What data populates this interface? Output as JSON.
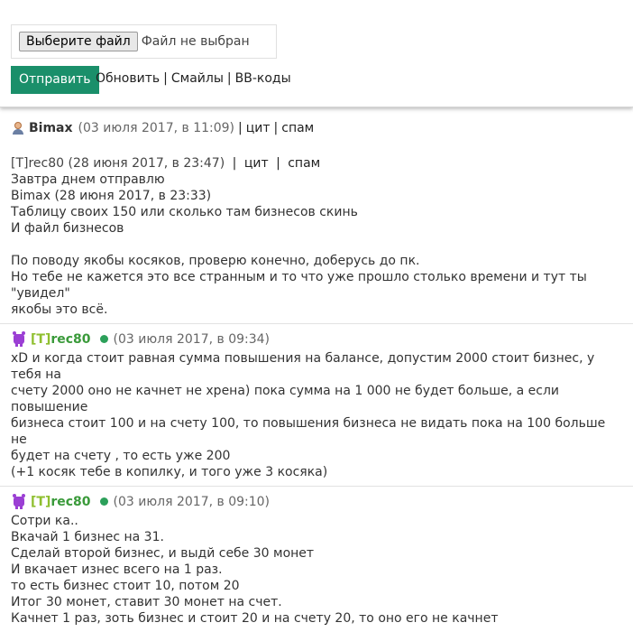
{
  "form": {
    "file_button": "Выберите файл",
    "file_status": "Файл не выбран",
    "submit": "Отправить",
    "refresh": "Обновить",
    "smiles": "Смайлы",
    "bbcodes": "BB-коды",
    "separator": "|"
  },
  "meta": {
    "quote": "цит",
    "spam": "спам"
  },
  "posts": [
    {
      "author": "Bimax",
      "date": "(03 июля 2017, в 11:09)",
      "quote_author_line": "[T]rec80 (28 июня 2017, в 23:47)",
      "quote_lines": [
        "Завтра днем отправлю"
      ],
      "nested_author_line": "Bimax (28 июня 2017, в 23:33)",
      "nested_lines": [
        "Таблицу своих 150 или сколько там бизнесов скинь",
        "И файл бизнесов"
      ],
      "body_lines": [
        "По поводу якобы косяков, проверю конечно, доберусь до пк.",
        "Но тебе не кажется это все странным и то что уже прошло столько времени и тут ты \"увидел\"",
        "якобы это всё."
      ]
    },
    {
      "author_bracket": "[T]",
      "author_rest": "rec80",
      "date": "(03 июля 2017, в 09:34)",
      "body_lines": [
        "xD и когда стоит равная сумма повышения на балансе, допустим 2000 стоит бизнес, у тебя на",
        "счету 2000 оно не качнет не хрена) пока сумма на 1 000 не будет больше, а если повышение",
        "бизнеса стоит 100 и на счету 100, то повышения бизнеса не видать пока на 100 больше не",
        "будет на счету , то есть уже 200",
        "(+1 косяк тебе в копилку, и того уже 3 косяка)"
      ]
    },
    {
      "author_bracket": "[T]",
      "author_rest": "rec80",
      "date": "(03 июля 2017, в 09:10)",
      "body_lines": [
        "Сотри ка..",
        "Вкачай 1 бизнес на 31.",
        "Сделай второй бизнес, и выдй себе 30 монет",
        "И вкачает изнес всего на 1 раз.",
        "то есть бизнес стоит 10, потом 20",
        "Итог 30 монет, ставит 30 монет на счет.",
        "Качнет 1 раз, зоть бизнес и стоит 20 и на счету 20, то оно его не качнет"
      ]
    }
  ]
}
